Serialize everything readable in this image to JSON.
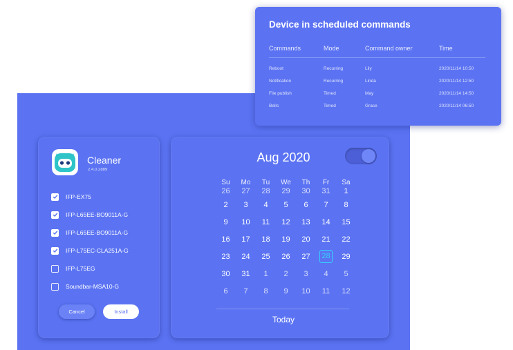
{
  "app": {
    "name": "Cleaner",
    "version": "2.4.0.2889",
    "icon": "robot-icon"
  },
  "devices": [
    {
      "name": "IFP-EX75",
      "checked": true
    },
    {
      "name": "IFP-L65EE-BO9011A-G",
      "checked": true
    },
    {
      "name": "IFP-L65EE-BO9011A-G",
      "checked": true
    },
    {
      "name": "IFP-L75EC-CLA251A-G",
      "checked": true
    },
    {
      "name": "IFP-L75EG",
      "checked": false
    },
    {
      "name": "Soundbar-MSA10-G",
      "checked": false
    }
  ],
  "buttons": {
    "cancel": "Cancel",
    "install": "Install"
  },
  "calendar": {
    "month": "Aug 2020",
    "toggle_on": true,
    "weekdays": [
      "Su",
      "Mo",
      "Tu",
      "We",
      "Th",
      "Fr",
      "Sa"
    ],
    "weeks": [
      [
        "26",
        "27",
        "28",
        "29",
        "30",
        "31",
        "1"
      ],
      [
        "2",
        "3",
        "4",
        "5",
        "6",
        "7",
        "8"
      ],
      [
        "9",
        "10",
        "11",
        "12",
        "13",
        "14",
        "15"
      ],
      [
        "16",
        "17",
        "18",
        "19",
        "20",
        "21",
        "22"
      ],
      [
        "23",
        "24",
        "25",
        "26",
        "27",
        "28",
        "29"
      ],
      [
        "30",
        "31",
        "1",
        "2",
        "3",
        "4",
        "5"
      ],
      [
        "6",
        "7",
        "8",
        "9",
        "10",
        "11",
        "12"
      ]
    ],
    "selected": "28",
    "today_label": "Today"
  },
  "scheduled": {
    "title": "Device in scheduled commands",
    "headers": [
      "Commands",
      "Mode",
      "Command owner",
      "Time"
    ],
    "rows": [
      [
        "Reboot",
        "Recurring",
        "Lily",
        "2020/11/14 10:50"
      ],
      [
        "Notification",
        "Recurring",
        "Linda",
        "2020/11/14 12:50"
      ],
      [
        "File publish",
        "Timed",
        "May",
        "2020/11/14 14:50"
      ],
      [
        "Bells",
        "Timed",
        "Grace",
        "2020/11/14 06:50"
      ]
    ]
  },
  "colors": {
    "accent": "#5b73f2",
    "selected": "#33d0ff",
    "icon_face": "#2ec4c8"
  }
}
